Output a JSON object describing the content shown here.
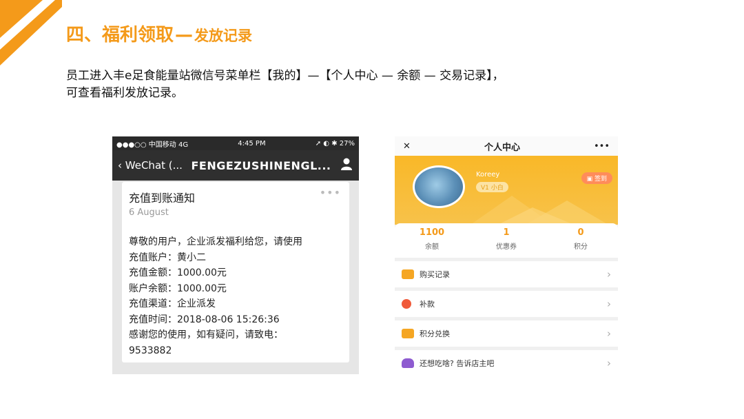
{
  "slide": {
    "title_main": "四、福利领取",
    "title_dash": "—",
    "title_sub": "发放记录",
    "desc_line1": "员工进入丰e足食能量站微信号菜单栏【我的】—【个人中心 — 余额 — 交易记录】，",
    "desc_line2": "可查看福利发放记录。",
    "accent": "#F49A1A"
  },
  "wechat": {
    "carrier": "●●●○○ 中国移动  4G",
    "time": "4:45 PM",
    "battery": "➚ ◐ ✱ 27%",
    "back_label": "WeChat (...",
    "account_name": "FENGEZUSHINENGL...",
    "card_title": "充值到账通知",
    "card_date": "6 August",
    "more": "•••",
    "lines": [
      "尊敬的用户，企业派发福利给您，请使用",
      "充值账户：黄小二",
      "充值金额：1000.00元",
      "账户余额：1000.00元",
      "充值渠道：企业派发",
      "充值时间：2018-08-06 15:26:36",
      "感谢您的使用，如有疑问，请致电：",
      "9533882"
    ]
  },
  "app": {
    "close": "✕",
    "title": "个人中心",
    "more": "•••",
    "username": "Koreey",
    "level": "V1 小白",
    "checkin": "签到",
    "stats": [
      {
        "value": "1100",
        "label": "余额"
      },
      {
        "value": "1",
        "label": "优惠券"
      },
      {
        "value": "0",
        "label": "积分"
      }
    ],
    "menu": [
      {
        "label": "购买记录",
        "color": "#F5A623"
      },
      {
        "label": "补款",
        "color": "#F05A3A"
      },
      {
        "label": "积分兑换",
        "color": "#F5A623"
      },
      {
        "label": "还想吃啥? 告诉店主吧",
        "color": "#8E5BD0"
      }
    ],
    "arrow": "›"
  }
}
